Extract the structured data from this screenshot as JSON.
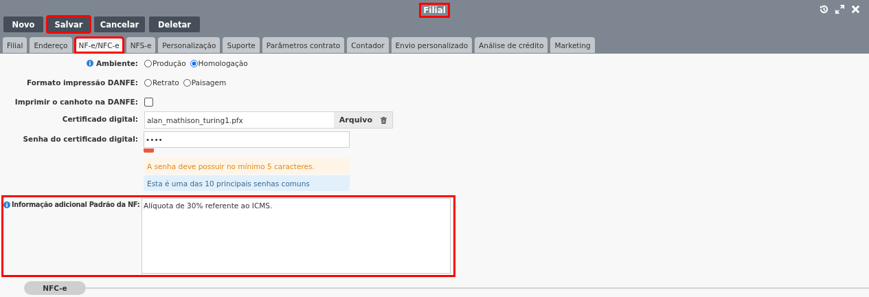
{
  "window": {
    "title": "Filial",
    "title_highlighted": true
  },
  "toolbar": [
    {
      "label": "Novo",
      "highlighted": false
    },
    {
      "label": "Salvar",
      "highlighted": true
    },
    {
      "label": "Cancelar",
      "highlighted": false
    },
    {
      "label": "Deletar",
      "highlighted": false
    }
  ],
  "tabs": [
    {
      "label": "Filial",
      "selected": false,
      "highlighted": false
    },
    {
      "label": "Endereço",
      "selected": false,
      "highlighted": false
    },
    {
      "label": "NF-e/NFC-e",
      "selected": true,
      "highlighted": true
    },
    {
      "label": "NFS-e",
      "selected": false,
      "highlighted": false
    },
    {
      "label": "Personalização",
      "selected": false,
      "highlighted": false
    },
    {
      "label": "Suporte",
      "selected": false,
      "highlighted": false
    },
    {
      "label": "Parâmetros contrato",
      "selected": false,
      "highlighted": false
    },
    {
      "label": "Contador",
      "selected": false,
      "highlighted": false
    },
    {
      "label": "Envio personalizado",
      "selected": false,
      "highlighted": false
    },
    {
      "label": "Análise de crédito",
      "selected": false,
      "highlighted": false
    },
    {
      "label": "Marketing",
      "selected": false,
      "highlighted": false
    }
  ],
  "form": [
    {
      "kind": "radio",
      "label": "Ambiente:",
      "info": true,
      "options": [
        {
          "label": "Produção",
          "selected": false
        },
        {
          "label": "Homologação",
          "selected": true
        }
      ]
    },
    {
      "kind": "radio",
      "label": "Formato impressão DANFE:",
      "info": false,
      "options": [
        {
          "label": "Retrato",
          "selected": false
        },
        {
          "label": "Paisagem",
          "selected": false
        }
      ]
    },
    {
      "kind": "checkbox",
      "label": "Imprimir o canhoto na DANFE:",
      "info": false,
      "checked": false
    },
    {
      "kind": "file",
      "label": "Certificado digital:",
      "info": false,
      "value": "alan_mathison_turing1.pfx",
      "button": "Arquivo"
    },
    {
      "kind": "password",
      "label": "Senha do certificado digital:",
      "info": false,
      "value": "••••",
      "level": 0.05,
      "messages": [
        {
          "kind": "warning",
          "text": "A senha deve possuir no mínimo 5 caracteres."
        },
        {
          "kind": "info",
          "text": "Esta é uma das 10 principais senhas comuns"
        }
      ]
    },
    {
      "kind": "textarea",
      "label": "Informação adicional Padrão da NF:",
      "info": true,
      "value": "Alíquota de 30% referente ao ICMS.",
      "highlighted": true
    }
  ],
  "section": {
    "label": "NFC-e"
  }
}
